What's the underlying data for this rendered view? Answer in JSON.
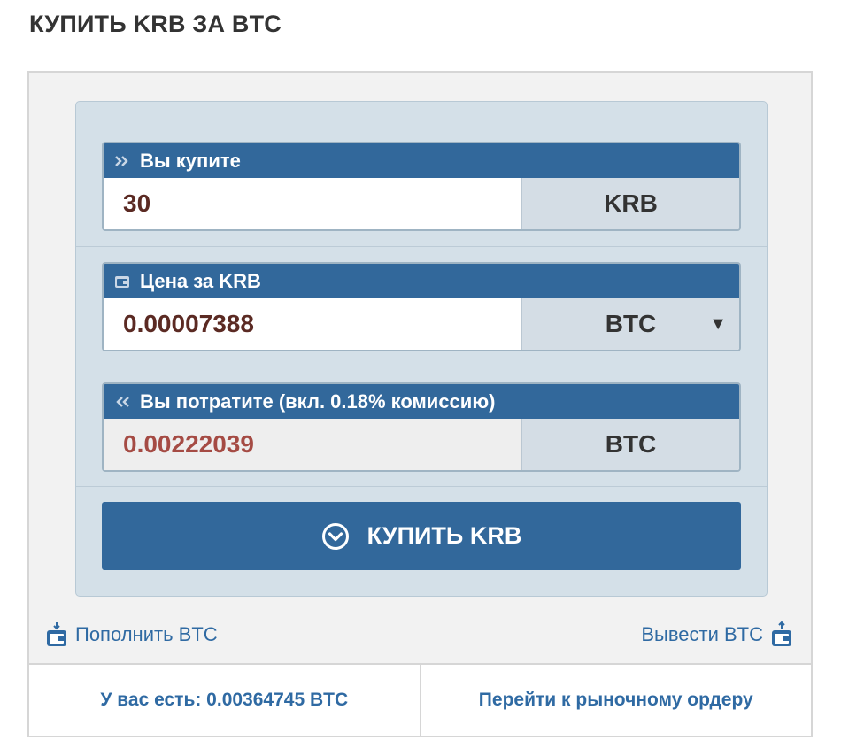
{
  "page": {
    "title": "КУПИТЬ KRB ЗА BTC"
  },
  "form": {
    "amount": {
      "label": "Вы купите",
      "value": "30",
      "unit": "KRB"
    },
    "price": {
      "label": "Цена за KRB",
      "value": "0.00007388",
      "unit": "BTC",
      "caret": "▼"
    },
    "total": {
      "label": "Вы потратите (вкл. 0.18% комиссию)",
      "value": "0.00222039",
      "unit": "BTC"
    },
    "buy_button": {
      "label": "КУПИТЬ KRB"
    }
  },
  "links": {
    "deposit": "Пополнить BTC",
    "withdraw": "Вывести BTC"
  },
  "footer": {
    "balance": "У вас есть: 0.00364745 BTC",
    "market_order": "Перейти к рыночному ордеру"
  },
  "colors": {
    "accent": "#32689b",
    "panel": "#d4e0e8",
    "value_text": "#5b2a23",
    "total_text": "#a54b44",
    "link": "#2f6aa3"
  },
  "icons": {
    "amount": "double-chevron-right-icon",
    "price": "wallet-icon",
    "total": "double-chevron-left-icon",
    "buy": "circle-chevron-down-icon",
    "deposit": "wallet-in-icon",
    "withdraw": "wallet-out-icon"
  }
}
